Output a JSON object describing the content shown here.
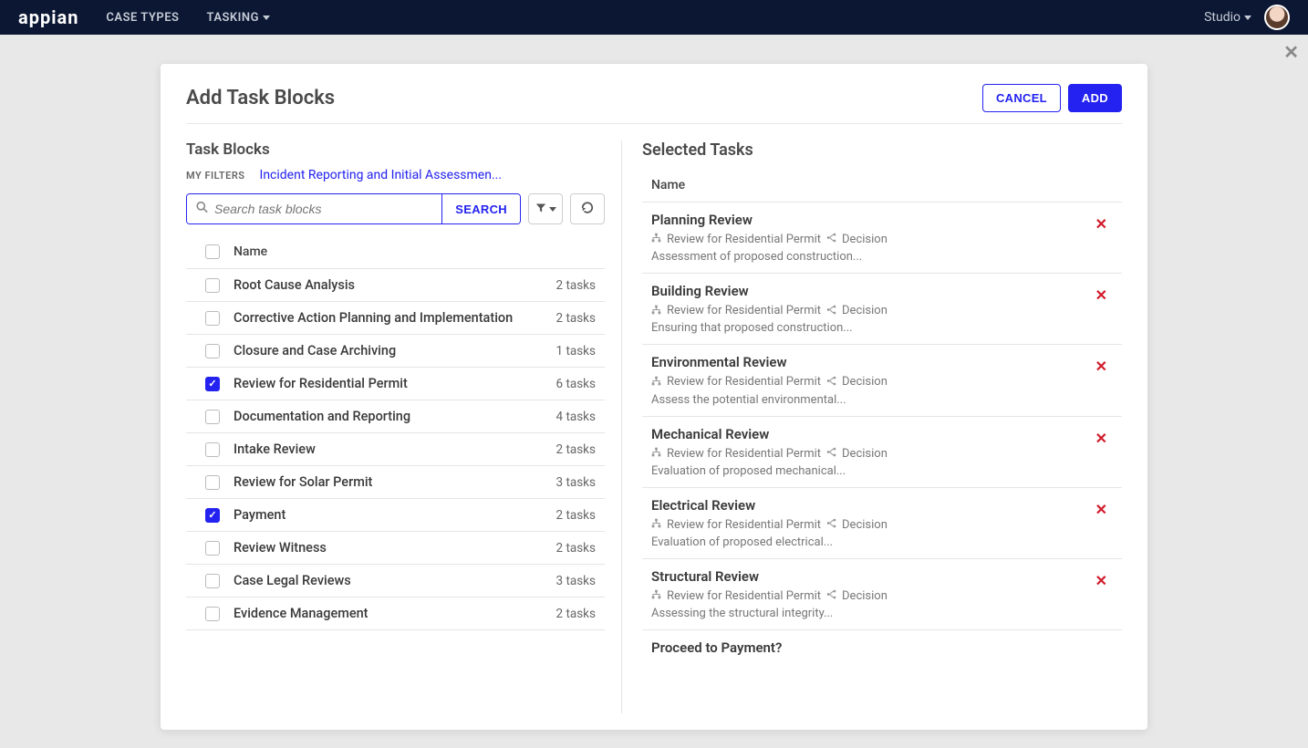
{
  "topbar": {
    "logo": "appian",
    "nav": [
      {
        "label": "CASE TYPES",
        "dropdown": false
      },
      {
        "label": "TASKING",
        "dropdown": true
      }
    ],
    "studio_label": "Studio"
  },
  "modal": {
    "title": "Add Task Blocks",
    "cancel_label": "CANCEL",
    "add_label": "ADD"
  },
  "left": {
    "title": "Task Blocks",
    "filters_label": "MY FILTERS",
    "filters_link": "Incident Reporting and Initial Assessmen...",
    "search_placeholder": "Search task blocks",
    "search_button": "SEARCH",
    "name_header": "Name",
    "blocks": [
      {
        "name": "Root Cause Analysis",
        "count": "2 tasks",
        "checked": false
      },
      {
        "name": "Corrective Action Planning and Implementation",
        "count": "2 tasks",
        "checked": false
      },
      {
        "name": "Closure and Case Archiving",
        "count": "1 tasks",
        "checked": false
      },
      {
        "name": "Review for Residential Permit",
        "count": "6 tasks",
        "checked": true
      },
      {
        "name": "Documentation and Reporting",
        "count": "4 tasks",
        "checked": false
      },
      {
        "name": "Intake Review",
        "count": "2 tasks",
        "checked": false
      },
      {
        "name": "Review for Solar Permit",
        "count": "3 tasks",
        "checked": false
      },
      {
        "name": "Payment",
        "count": "2 tasks",
        "checked": true
      },
      {
        "name": "Review Witness",
        "count": "2 tasks",
        "checked": false
      },
      {
        "name": "Case Legal Reviews",
        "count": "3 tasks",
        "checked": false
      },
      {
        "name": "Evidence Management",
        "count": "2 tasks",
        "checked": false
      }
    ]
  },
  "right": {
    "title": "Selected Tasks",
    "name_header": "Name",
    "source_label": "Review for Residential Permit",
    "type_label": "Decision",
    "tasks": [
      {
        "title": "Planning Review",
        "desc": "Assessment of proposed construction..."
      },
      {
        "title": "Building Review",
        "desc": "Ensuring that proposed construction..."
      },
      {
        "title": "Environmental Review",
        "desc": "Assess the potential environmental..."
      },
      {
        "title": "Mechanical Review",
        "desc": "Evaluation of proposed mechanical..."
      },
      {
        "title": "Electrical Review",
        "desc": "Evaluation of proposed electrical..."
      },
      {
        "title": "Structural Review",
        "desc": "Assessing the structural integrity..."
      }
    ],
    "extra_task_title": "Proceed to Payment?"
  }
}
